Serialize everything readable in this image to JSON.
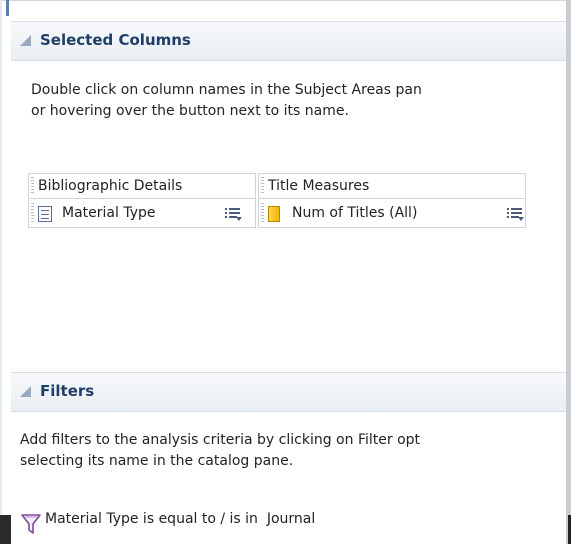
{
  "selected_columns": {
    "title": "Selected Columns",
    "desc_line1": "Double click on column names in the Subject Areas pan",
    "desc_line2": "or hovering over the button next to its name.",
    "groups": [
      {
        "label": "Bibliographic Details",
        "column": "Material Type",
        "column_icon": "attribute-column-icon"
      },
      {
        "label": "Title Measures",
        "column": "Num of Titles (All)",
        "column_icon": "measure-column-icon"
      }
    ]
  },
  "filters": {
    "title": "Filters",
    "desc_line1": "Add filters to the analysis criteria by clicking on Filter opt",
    "desc_line2": "selecting its name in the catalog pane.",
    "items": [
      {
        "text": "Material Type is equal to / is in  Journal",
        "icon": "filter-funnel-icon"
      }
    ]
  }
}
